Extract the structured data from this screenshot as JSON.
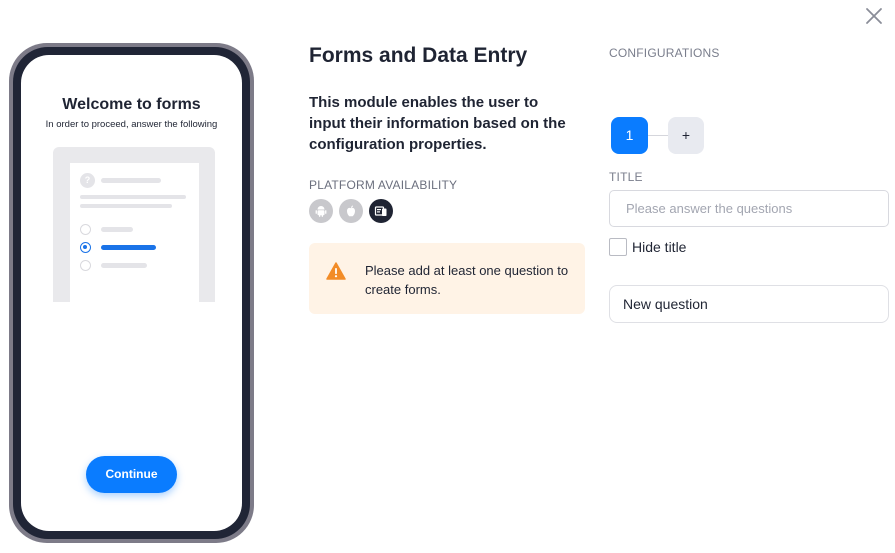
{
  "close": {
    "icon": "close-icon"
  },
  "preview": {
    "title": "Welcome to forms",
    "subtitle": "In order to proceed, answer the following",
    "question_icon": "?",
    "continue_label": "Continue"
  },
  "module": {
    "title": "Forms and Data Entry",
    "description": "This module enables the user to input their information based on the configuration properties.",
    "platform_label": "PLATFORM AVAILABILITY",
    "platforms": [
      {
        "icon": "android-icon",
        "active": false
      },
      {
        "icon": "apple-icon",
        "active": false
      },
      {
        "icon": "web-mobile-icon",
        "active": true
      }
    ],
    "warning": "Please add at least one question to create forms."
  },
  "config": {
    "label": "CONFIGURATIONS",
    "steps": [
      "1",
      "+"
    ],
    "title_label": "TITLE",
    "title_placeholder": "Please answer the questions",
    "title_value": "",
    "hide_title_label": "Hide title",
    "hide_title_checked": false,
    "new_question_label": "New question"
  },
  "colors": {
    "accent": "#0a7cff",
    "warning_bg": "#fff3e6",
    "warning_icon": "#f28c28",
    "dark": "#1f2433"
  }
}
